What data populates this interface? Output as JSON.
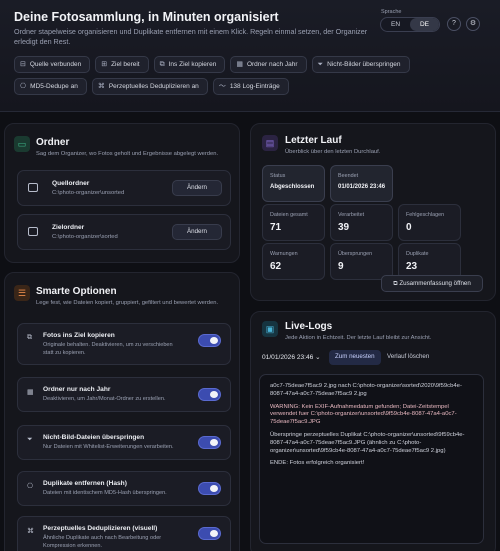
{
  "header": {
    "title": "Deine Fotosammlung, in Minuten organisiert",
    "subtitle": "Ordner stapelweise organisieren und Duplikate entfernen mit einem Klick. Regeln einmal setzen, der Organizer erledigt den Rest.",
    "language_label": "Sprache",
    "lang_en": "EN",
    "lang_de": "DE",
    "help_icon": "?",
    "settings_icon": "⚙",
    "chips": [
      {
        "label": "Quelle verbunden",
        "icon": "⊟"
      },
      {
        "label": "Ziel bereit",
        "icon": "⊞"
      },
      {
        "label": "Ins Ziel kopieren",
        "icon": "⧉"
      },
      {
        "label": "Ordner nach Jahr",
        "icon": "▦"
      },
      {
        "label": "Nicht-Bilder überspringen",
        "icon": "⏷"
      },
      {
        "label": "MD5-Dedupe an",
        "icon": "⎔"
      },
      {
        "label": "Perzeptuelles Deduplizieren an",
        "icon": "⌘"
      },
      {
        "label": "138 Log-Einträge",
        "icon": "〜"
      }
    ]
  },
  "folders": {
    "title": "Ordner",
    "subtitle": "Sag dem Organizer, wo Fotos geholt und Ergebnisse abgelegt werden.",
    "source": {
      "label": "Quellordner",
      "path": "C:\\photo-organizer\\unsorted",
      "button": "Ändern"
    },
    "target": {
      "label": "Zielordner",
      "path": "C:\\photo-organizer\\sorted",
      "button": "Ändern"
    }
  },
  "options": {
    "title": "Smarte Optionen",
    "subtitle": "Lege fest, wie Dateien kopiert, gruppiert, gefiltert und bewertet werden.",
    "items": [
      {
        "label": "Fotos ins Ziel kopieren",
        "desc": "Originale behalten. Deaktivieren, um zu verschieben statt zu kopieren.",
        "icon": "⧉"
      },
      {
        "label": "Ordner nur nach Jahr",
        "desc": "Deaktivieren, um Jahr/Monat-Ordner zu erstellen.",
        "icon": "▦"
      },
      {
        "label": "Nicht-Bild-Dateien überspringen",
        "desc": "Nur Dateien mit Whitelist-Erweiterungen verarbeiten.",
        "icon": "⏷"
      },
      {
        "label": "Duplikate entfernen (Hash)",
        "desc": "Dateien mit identischem MD5-Hash überspringen.",
        "icon": "⎔"
      },
      {
        "label": "Perzeptuelles Deduplizieren (visuell)",
        "desc": "Ähnliche Duplikate auch nach Bearbeitung oder Kompression erkennen.",
        "icon": "⌘"
      }
    ]
  },
  "last_run": {
    "title": "Letzter Lauf",
    "subtitle": "Überblick über den letzten Durchlauf.",
    "status_label": "Status",
    "status_value": "Abgeschlossen",
    "finished_label": "Beendet",
    "finished_value": "01/01/2026 23:46",
    "stats": [
      {
        "label": "Dateien gesamt",
        "value": "71"
      },
      {
        "label": "Verarbeitet",
        "value": "39"
      },
      {
        "label": "Fehlgeschlagen",
        "value": "0"
      },
      {
        "label": "Warnungen",
        "value": "62"
      },
      {
        "label": "Übersprungen",
        "value": "9"
      },
      {
        "label": "Duplikate",
        "value": "23"
      }
    ],
    "summary_button": "Zusammenfassung öffnen"
  },
  "logs": {
    "title": "Live-Logs",
    "subtitle": "Jede Aktion in Echtzeit. Der letzte Lauf bleibt zur Ansicht.",
    "run_select": "01/01/2026 23:46 ⌄",
    "newest_button": "Zum neuesten",
    "clear_button": "Verlauf löschen",
    "lines": [
      {
        "text": "a0c7-75deae7f5ac9 2.jpg nach C:\\photo-organizer\\sorted\\2020\\9f59cb4e-8087-47a4-a0c7-75deae7f5ac9 2.jpg",
        "warn": false
      },
      {
        "text": "WARNING: Kein EXIF-Aufnahmedatum gefunden; Datei-Zeitstempel verwendet fuer C:\\photo-organizer\\unsorted\\9f59cb4e-8087-47a4-a0c7-75deae7f5ac9.JPG",
        "warn": true
      },
      {
        "text": "Überspringe perzeptuelles Duplikat C:\\photo-organizer\\unsorted\\9f59cb4e-8087-47a4-a0c7-75deae7f5ac9.JPG (ähnlich zu C:\\photo-organizer\\unsorted\\9f59cb4e-8087-47a4-a0c7-75deae7f5ac9 2.jpg)",
        "warn": false
      },
      {
        "text": "ENDE: Fotos erfolgreich organisiert!",
        "warn": false
      }
    ]
  },
  "colors": {
    "accent": "#3c4cb0",
    "folders_icon": "#3fb68a",
    "options_icon": "#e8894a",
    "lastrun_icon": "#8a6fd8",
    "logs_icon": "#4ab3d6"
  }
}
